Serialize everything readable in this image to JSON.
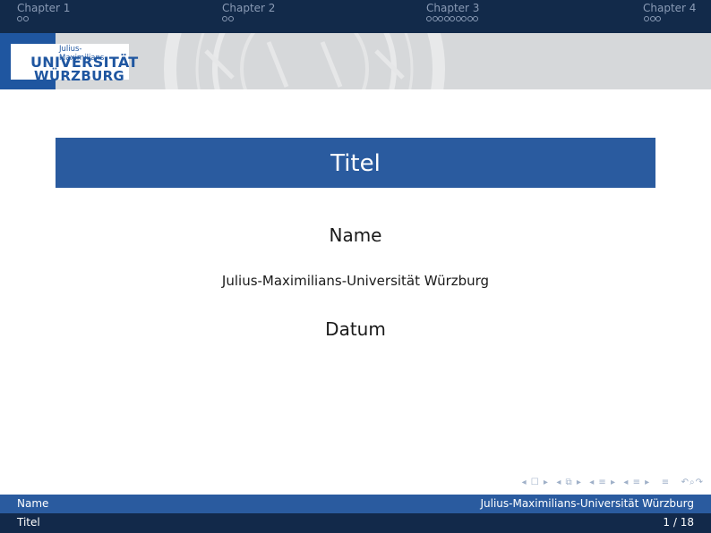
{
  "nav": {
    "chapters": [
      {
        "label": "Chapter 1",
        "dots": 2
      },
      {
        "label": "Chapter 2",
        "dots": 2
      },
      {
        "label": "Chapter 3",
        "dots": 9
      },
      {
        "label": "Chapter 4",
        "dots": 3
      }
    ]
  },
  "logo": {
    "line1": "Julius-Maximilians-",
    "line2": "UNIVERSITÄT",
    "line3": "WÜRZBURG"
  },
  "slide": {
    "title": "Titel",
    "author": "Name",
    "institute": "Julius-Maximilians-Universität Würzburg",
    "date": "Datum"
  },
  "footer": {
    "left_top": "Name",
    "right_top": "Julius-Maximilians-Universität Würzburg",
    "left_bottom": "Titel",
    "page": "1 / 18"
  },
  "colors": {
    "navy": "#122a4a",
    "blue": "#2a5b9f",
    "logo_blue": "#1f56a0"
  }
}
